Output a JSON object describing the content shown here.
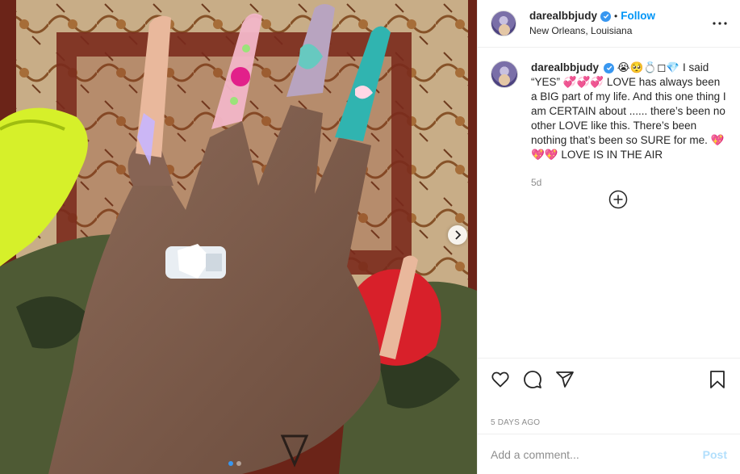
{
  "post": {
    "username": "darealbbjudy",
    "follow_label": "Follow",
    "separator": "•",
    "location": "New Orleans, Louisiana",
    "caption_emojis": "😭🥺💍◻💎",
    "caption": "I said “YES” 💞💞💞 LOVE has always been a BIG part of my life. And this one thing I am CERTAIN about ...... there’s been no other LOVE like this. There’s been nothing that’s been so SURE for me. 💖💖💖 LOVE IS IN THE AIR",
    "caption_age": "5d",
    "date": "5 DAYS AGO",
    "carousel": {
      "count": 2,
      "active": 1
    }
  },
  "comment_box": {
    "placeholder": "Add a comment...",
    "post_label": "Post"
  },
  "icons": {
    "verified": "verified-badge-icon",
    "more": "more-options-icon",
    "load_more": "plus-circle-icon",
    "like": "heart-icon",
    "comment": "comment-bubble-icon",
    "share": "paper-plane-icon",
    "save": "bookmark-icon",
    "next": "chevron-right-icon"
  },
  "colors": {
    "accent": "#0095f6",
    "verified": "#3897f0",
    "post_disabled": "#b2dffc",
    "muted": "#8e8e8e"
  }
}
